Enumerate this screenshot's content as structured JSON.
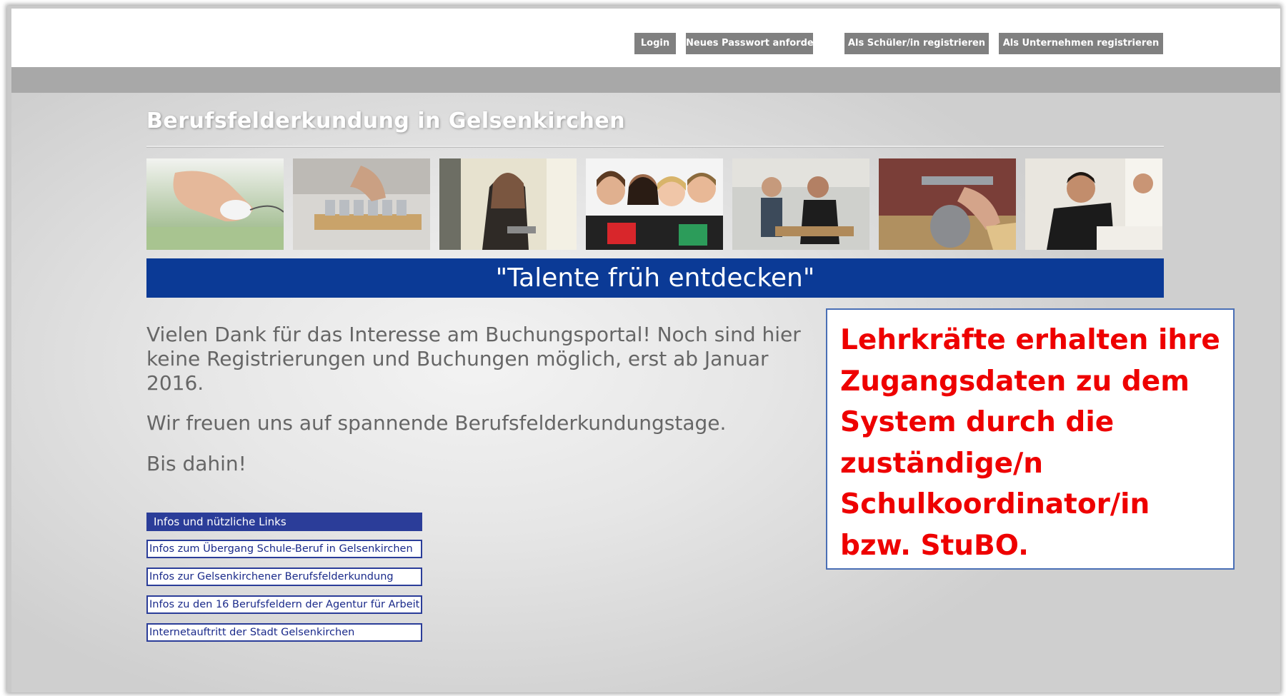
{
  "nav": {
    "login_label": "Login",
    "reset_password_label": "Neues Passwort anfordern",
    "register_student_label": "Als Schüler/in registrieren",
    "register_company_label": "Als Unternehmen registrieren"
  },
  "header": {
    "site_title": "Berufsfelderkundung in Gelsenkirchen"
  },
  "banner": {
    "slogan": "\"Talente früh entdecken\""
  },
  "intro": {
    "paragraph_1": "Vielen Dank für das Interesse am Buchungsportal! Noch sind hier keine Registrierungen und Buchungen möglich, erst ab Januar 2016.",
    "paragraph_2": "Wir freuen uns auf spannende Berufsfelderkundungstage.",
    "paragraph_3": "Bis dahin!"
  },
  "links": {
    "heading": "Infos und nützliche Links",
    "items": [
      "Infos zum Übergang Schule-Beruf in Gelsenkirchen",
      "Infos zur Gelsenkirchener Berufsfelderkundung",
      "Infos zu den 16 Berufsfeldern der Agentur für Arbeit",
      "Internetauftritt der Stadt Gelsenkirchen"
    ]
  },
  "note": {
    "text": "Lehrkräfte erhalten ihre Zugangsdaten zu dem System durch die zuständige/n Schulkoordinator/in bzw. StuBO."
  },
  "colors": {
    "nav_button": "#808080",
    "slogan_bar": "#0b3a96",
    "links_accent": "#2b3d99",
    "note_text": "#ee0000"
  }
}
